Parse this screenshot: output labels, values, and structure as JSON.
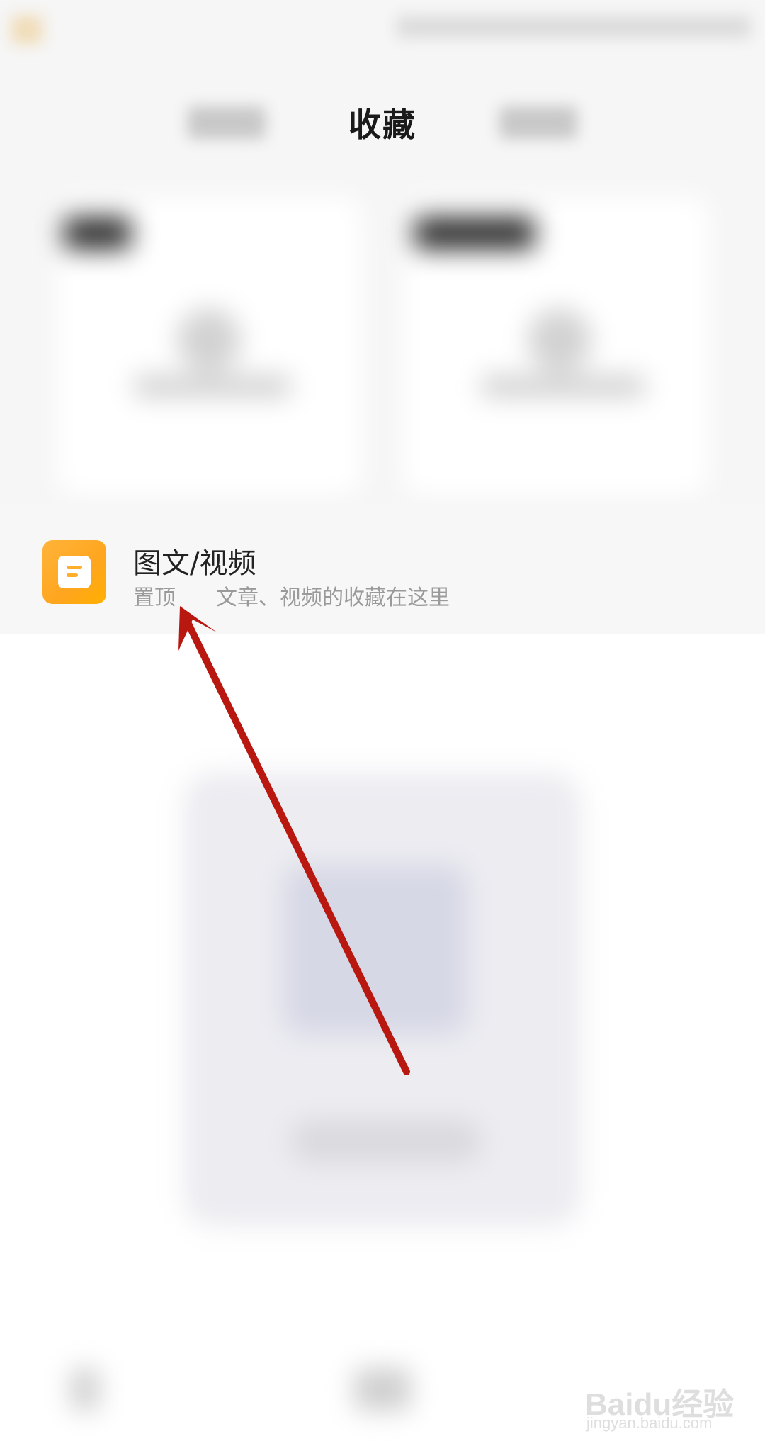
{
  "header": {
    "title": "收藏"
  },
  "list_item": {
    "title": "图文/视频",
    "tag": "置顶",
    "description": "文章、视频的收藏在这里",
    "icon": "document-icon",
    "icon_color": "#FFA51E"
  },
  "annotation": {
    "arrow_color": "#B8180F"
  },
  "watermark": {
    "brand": "Baidu经验",
    "url": "jingyan.baidu.com"
  }
}
